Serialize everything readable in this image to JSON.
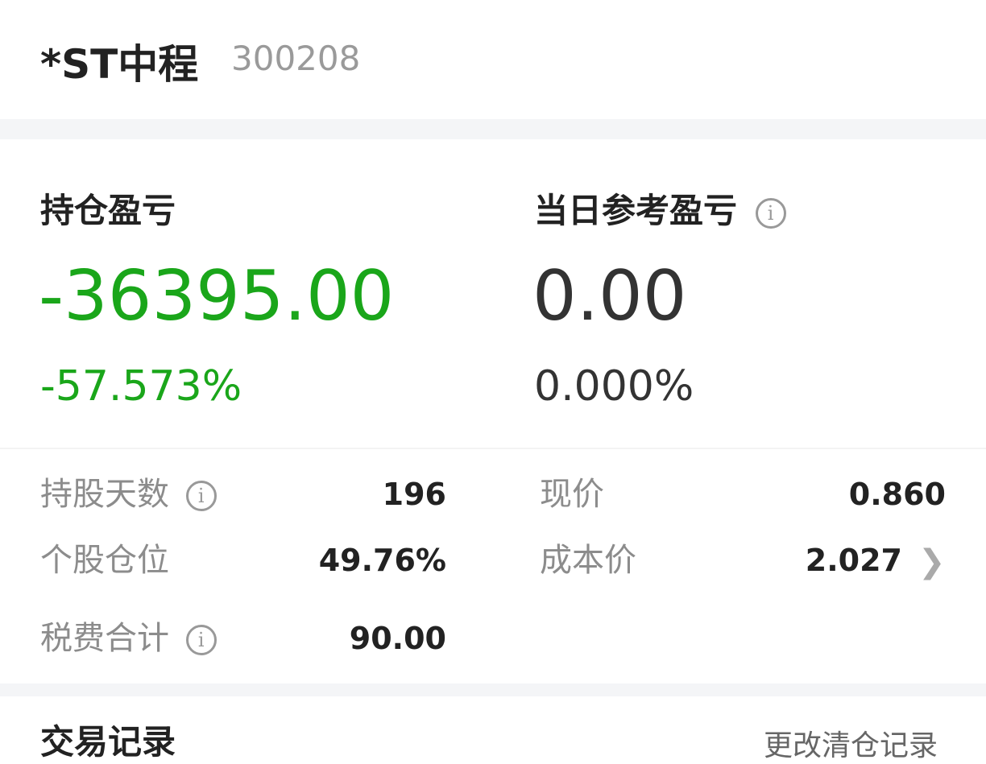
{
  "stock": {
    "name": "*ST中程",
    "code": "300208"
  },
  "position_pl": {
    "label": "持仓盈亏",
    "amount": "-36395.00",
    "percent": "-57.573%"
  },
  "daily_pl": {
    "label": "当日参考盈亏",
    "amount": "0.00",
    "percent": "0.000%"
  },
  "stats": {
    "hold_days": {
      "label": "持股天数",
      "value": "196"
    },
    "position_ratio": {
      "label": "个股仓位",
      "value": "49.76%"
    },
    "fees": {
      "label": "税费合计",
      "value": "90.00"
    },
    "current_price": {
      "label": "现价",
      "value": "0.860"
    },
    "cost_price": {
      "label": "成本价",
      "value": "2.027"
    }
  },
  "icons": {
    "info": "info-icon",
    "chevron": "chevron-right-icon"
  },
  "colors": {
    "loss": "#1aa61a",
    "text": "#222222",
    "muted": "#8c8c8c"
  },
  "section2": {
    "title": "交易记录",
    "link": "更改清仓记录"
  }
}
